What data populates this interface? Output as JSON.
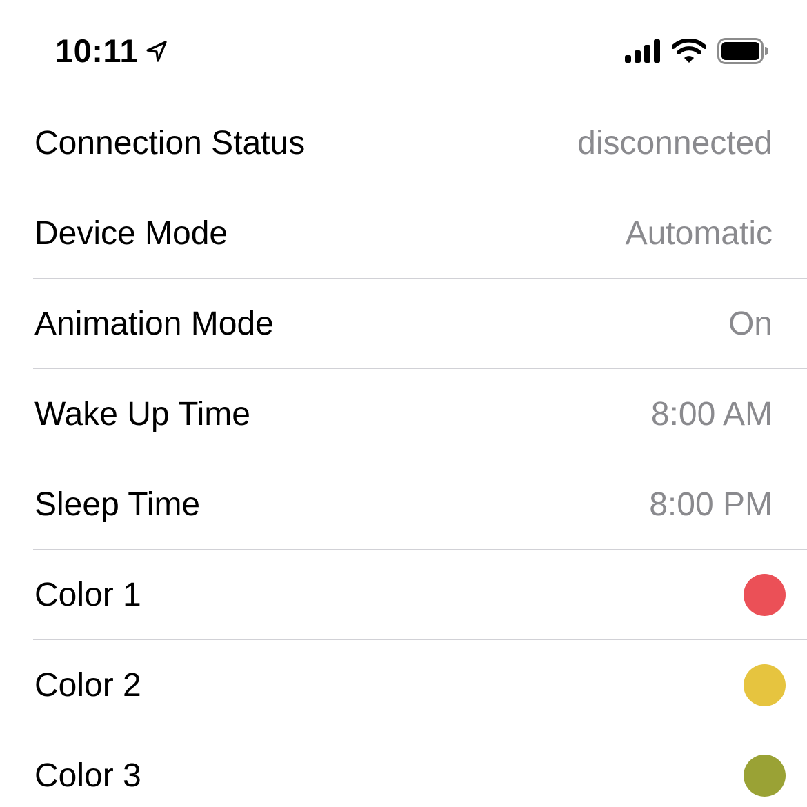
{
  "status_bar": {
    "time": "10:11",
    "location_icon": "location-arrow-icon",
    "signal_icon": "cellular-signal-icon",
    "wifi_icon": "wifi-icon",
    "battery_icon": "battery-icon"
  },
  "settings": {
    "connection_status": {
      "label": "Connection Status",
      "value": "disconnected"
    },
    "device_mode": {
      "label": "Device Mode",
      "value": "Automatic"
    },
    "animation_mode": {
      "label": "Animation Mode",
      "value": "On"
    },
    "wake_up_time": {
      "label": "Wake Up Time",
      "value": "8:00 AM"
    },
    "sleep_time": {
      "label": "Sleep Time",
      "value": "8:00 PM"
    },
    "color_1": {
      "label": "Color 1",
      "color": "#eb5057"
    },
    "color_2": {
      "label": "Color 2",
      "color": "#e6c43f"
    },
    "color_3": {
      "label": "Color 3",
      "color": "#9aa235"
    }
  },
  "colors": {
    "label_text": "#000000",
    "value_text": "#8a8a8e",
    "separator": "#d1d1d6",
    "background": "#ffffff"
  }
}
